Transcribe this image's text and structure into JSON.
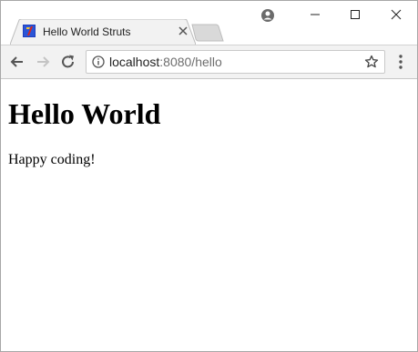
{
  "tab": {
    "title": "Hello World Struts",
    "favicon": "struts-logo-icon"
  },
  "window_controls": {
    "profile": "account-icon",
    "minimize": "minimize-icon",
    "maximize": "maximize-icon",
    "close": "close-icon"
  },
  "toolbar": {
    "url_host": "localhost",
    "url_rest": ":8080/hello"
  },
  "page": {
    "heading": "Hello World",
    "paragraph": "Happy coding!"
  },
  "colors": {
    "toolbar_bg": "#f2f2f2",
    "favicon_blue": "#1f3fbf",
    "favicon_red": "#d8261d"
  }
}
